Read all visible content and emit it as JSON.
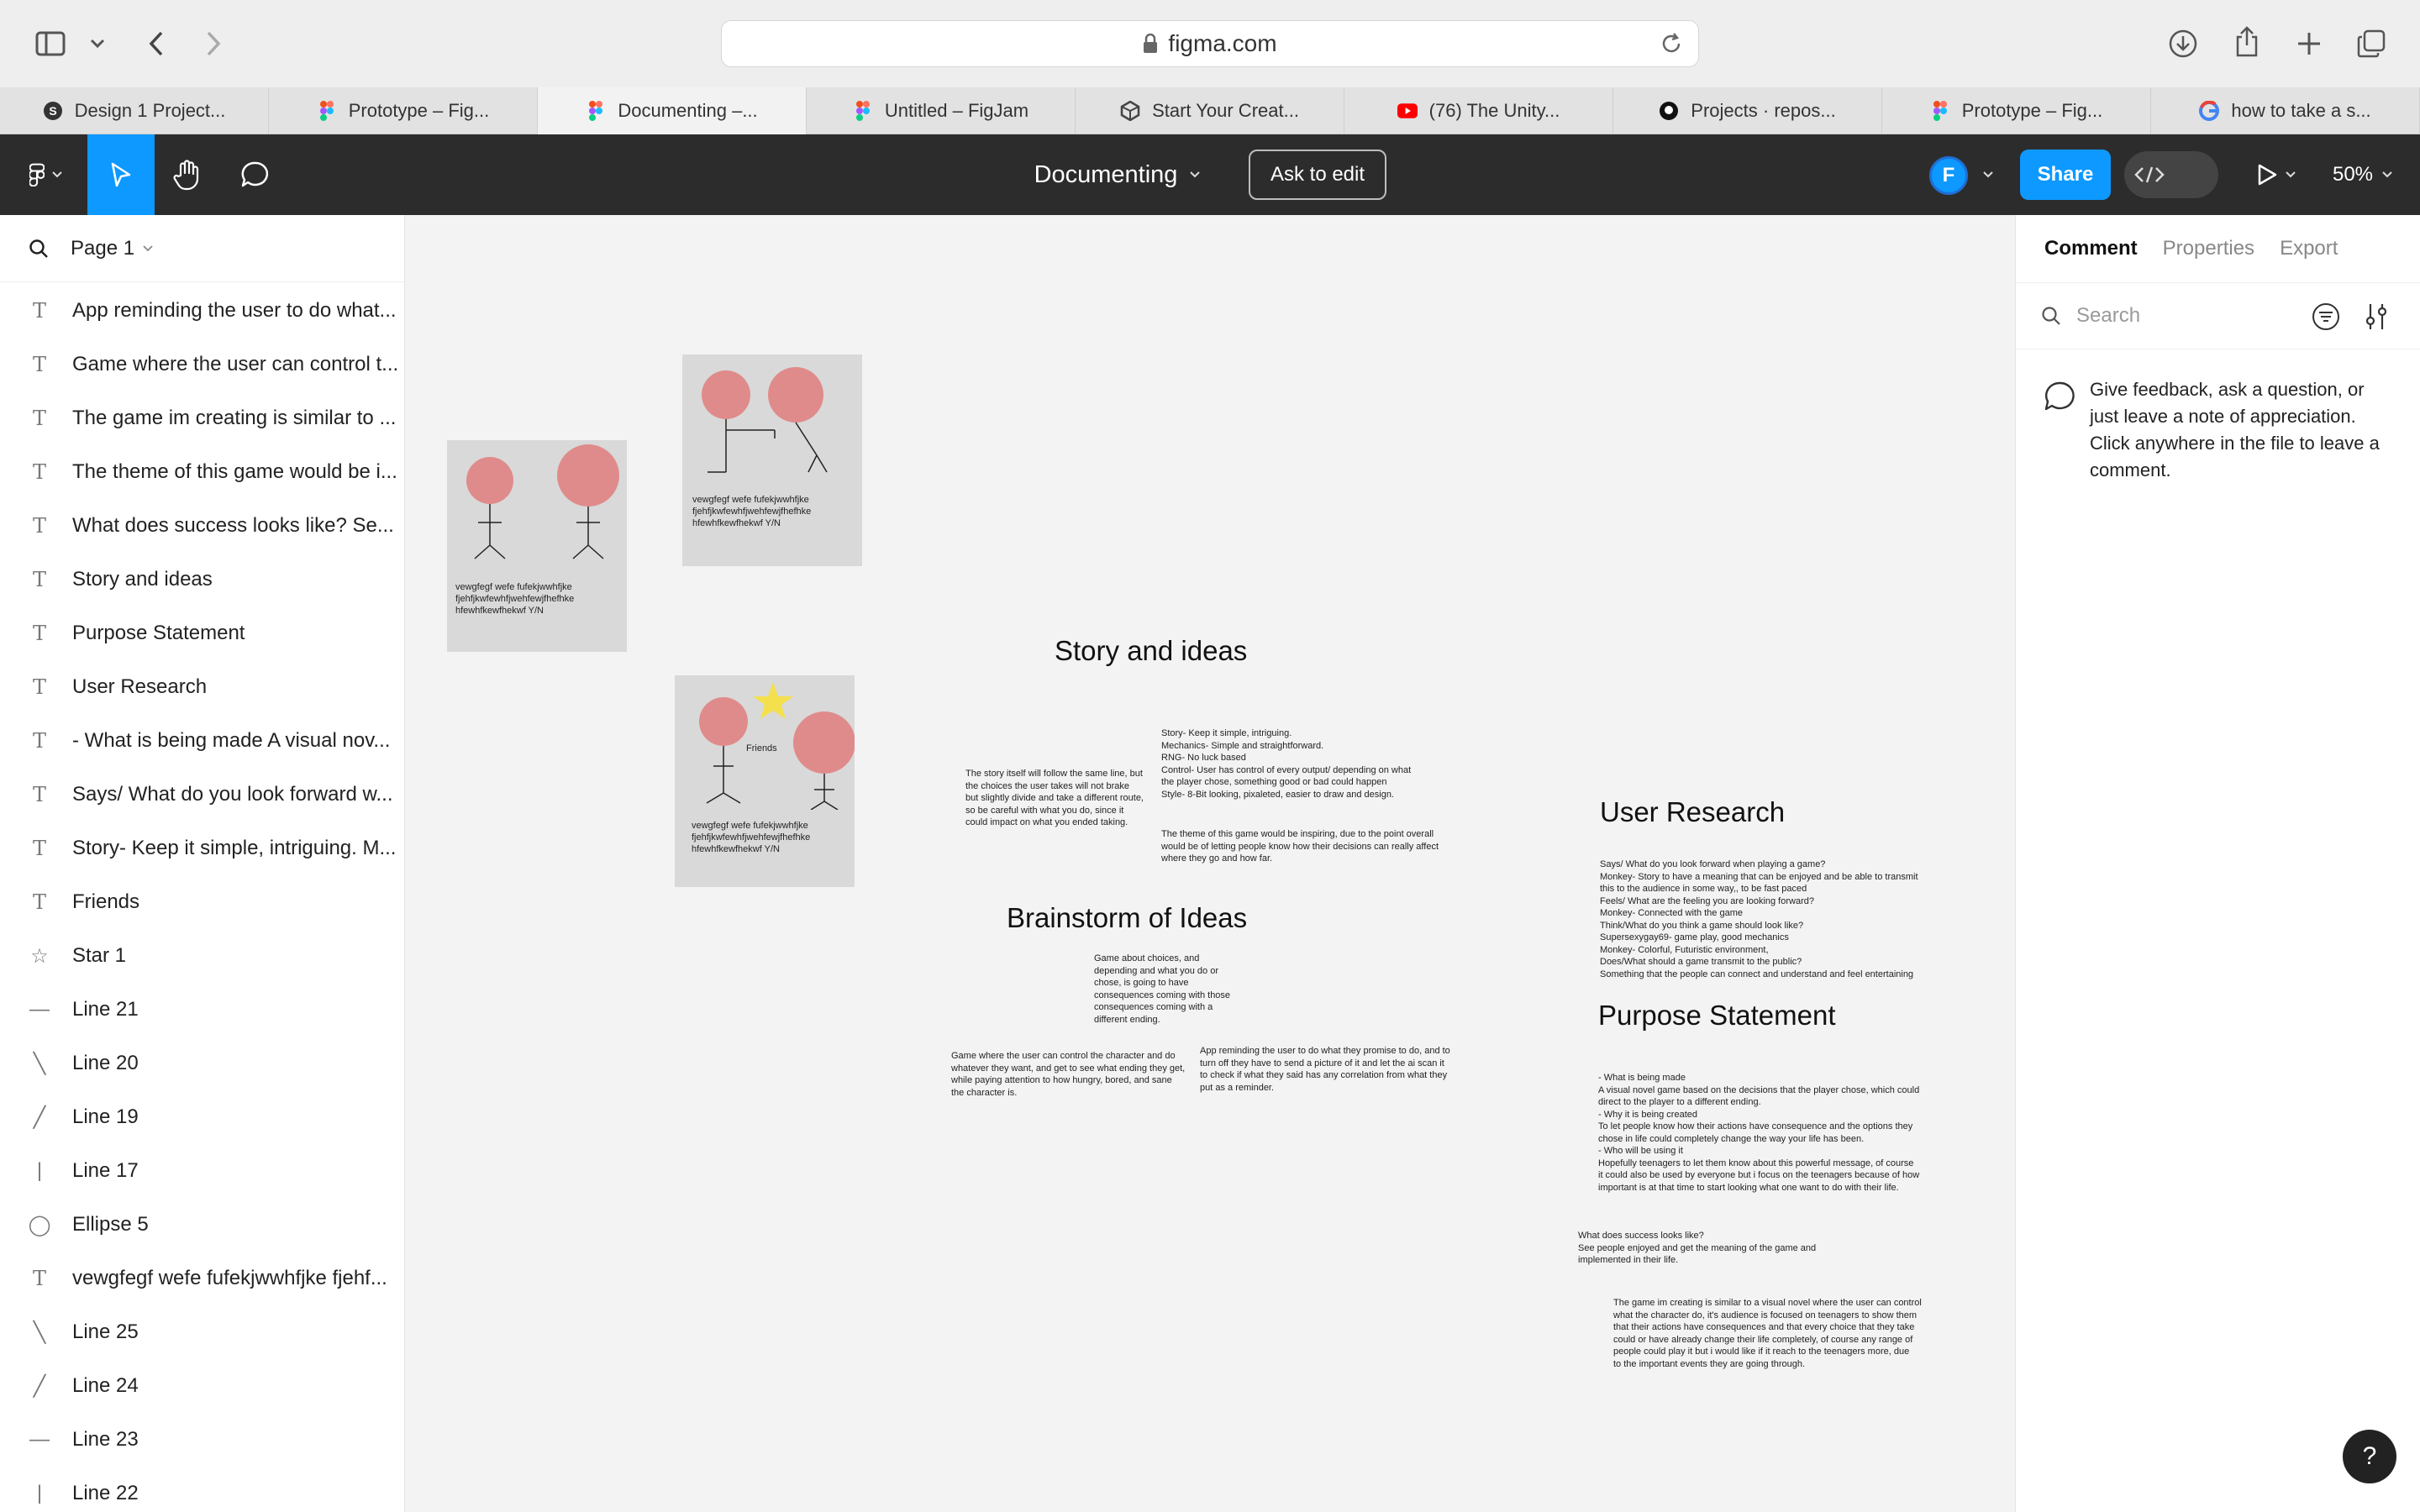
{
  "browser": {
    "url": "figma.com",
    "tabs": [
      {
        "label": "Design 1 Project...",
        "icon": "s-icon"
      },
      {
        "label": "Prototype – Fig...",
        "icon": "figma-icon"
      },
      {
        "label": "Documenting –...",
        "icon": "figma-icon",
        "active": true
      },
      {
        "label": "Untitled – FigJam",
        "icon": "figma-icon"
      },
      {
        "label": "Start Your Creat...",
        "icon": "unity-icon"
      },
      {
        "label": "(76) The Unity...",
        "icon": "youtube-icon"
      },
      {
        "label": "Projects · repos...",
        "icon": "github-icon"
      },
      {
        "label": "Prototype – Fig...",
        "icon": "figma-icon"
      },
      {
        "label": "how to take a s...",
        "icon": "google-icon"
      }
    ]
  },
  "toolbar": {
    "file_title": "Documenting",
    "ask_to_edit": "Ask to edit",
    "avatar_initial": "F",
    "share": "Share",
    "zoom": "50%"
  },
  "layers": {
    "page": "Page 1",
    "items": [
      {
        "icon": "T",
        "label": "App reminding the user to do what..."
      },
      {
        "icon": "T",
        "label": "Game where the user can control t..."
      },
      {
        "icon": "T",
        "label": "The game im creating is similar to ..."
      },
      {
        "icon": "T",
        "label": "The theme of this game would be i..."
      },
      {
        "icon": "T",
        "label": "What does success looks like? Se..."
      },
      {
        "icon": "T",
        "label": "Story and ideas"
      },
      {
        "icon": "T",
        "label": "Purpose Statement"
      },
      {
        "icon": "T",
        "label": "User Research"
      },
      {
        "icon": "T",
        "label": "- What is being made A visual nov..."
      },
      {
        "icon": "T",
        "label": "Says/ What do you look forward w..."
      },
      {
        "icon": "T",
        "label": "Story- Keep it simple, intriguing. M..."
      },
      {
        "icon": "T",
        "label": "Friends"
      },
      {
        "icon": "☆",
        "label": "Star 1"
      },
      {
        "icon": "—",
        "label": "Line 21"
      },
      {
        "icon": "╲",
        "label": "Line 20"
      },
      {
        "icon": "╱",
        "label": "Line 19"
      },
      {
        "icon": "|",
        "label": "Line 17"
      },
      {
        "icon": "◯",
        "label": "Ellipse 5"
      },
      {
        "icon": "T",
        "label": "vewgfegf wefe fufekjwwhfjke fjehf..."
      },
      {
        "icon": "╲",
        "label": "Line 25"
      },
      {
        "icon": "╱",
        "label": "Line 24"
      },
      {
        "icon": "—",
        "label": "Line 23"
      },
      {
        "icon": "|",
        "label": "Line 22"
      }
    ]
  },
  "right_panel": {
    "tabs": [
      "Comment",
      "Properties",
      "Export"
    ],
    "search_placeholder": "Search",
    "hint": "Give feedback, ask a question, or just leave a note of appreciation. Click anywhere in the file to leave a comment."
  },
  "canvas": {
    "card_text": "vewgfegf wefe fufekjwwhfjke fjehfjkwfewhfjwehfewjfhefhke hfewhfkewfhekwf Y/N",
    "friends_label": "Friends",
    "story_heading": "Story and ideas",
    "story_left": "The story itself will follow the same line, but the choices the user takes will not brake but slightly divide and take a different route, so be careful with what you do, since it could impact on what you ended taking.",
    "story_right_lines": [
      "Story- Keep it simple, intriguing.",
      "Mechanics- Simple and straightforward.",
      "RNG- No luck based",
      "Control- User has control of every output/ depending on what",
      "the player chose, something good or bad could happen",
      "Style- 8-Bit looking, pixaleted, easier to draw and design."
    ],
    "theme_text": "The theme of this game would be inspiring, due to the point overall would be of letting people know how their decisions can really affect where they go and how far.",
    "brainstorm_heading": "Brainstorm of Ideas",
    "brainstorm_center": "Game about choices, and depending and what you do or chose, is going to have consequences coming with those consequences coming with a different ending.",
    "brainstorm_left": "Game where the user can control the character and do whatever they want, and get to see what ending they get, while paying attention to how hungry, bored, and sane the character is.",
    "brainstorm_right": "App reminding the user to do what they promise to do, and to turn off they have to send a picture of it and let the ai scan it to check if what they said has any correlation from what they put as a reminder.",
    "research_heading": "User Research",
    "research_lines": [
      "Says/ What do you look forward when playing a game?",
      "Monkey- Story to have a meaning that can be enjoyed and be able to transmit",
      "this to the audience in some way,, to be fast paced",
      "Feels/ What are the feeling you are looking forward?",
      "Monkey- Connected with the game",
      "Think/What do you think a game should look like?",
      "Supersexygay69- game play, good mechanics",
      "Monkey- Colorful, Futuristic  environment,",
      "Does/What should a game transmit  to the public?",
      "Something that the people can connect and understand and feel entertaining"
    ],
    "purpose_heading": "Purpose Statement",
    "purpose_lines": [
      " - What is being made",
      "A visual novel game based on the decisions that the player chose, which could",
      "direct to the player to a different ending.",
      " - Why it is being created",
      "To let people know how their actions have consequence and the options they",
      "chose in life could completely change the way your life has been.",
      " - Who will be using it",
      "Hopefully teenagers to let them know about this powerful message, of course",
      "it could also be used by everyone but i focus on the teenagers because of how",
      "important is at that time to start looking what one want to do with their life."
    ],
    "success_lines": [
      "What does success looks like?",
      "See people enjoyed and get the meaning of the game and",
      "implemented in their life."
    ],
    "similar_lines": [
      "The game im creating is similar to a visual novel where the user can control",
      "what the character do, it's audience is focused on teenagers to show them",
      "that their actions have consequences and that every choice that they take",
      "could or have already change their life completely, of course any range of",
      "people could play it but i would like if it reach to the teenagers more, due",
      "to the important events they are going through."
    ]
  },
  "help": "?"
}
